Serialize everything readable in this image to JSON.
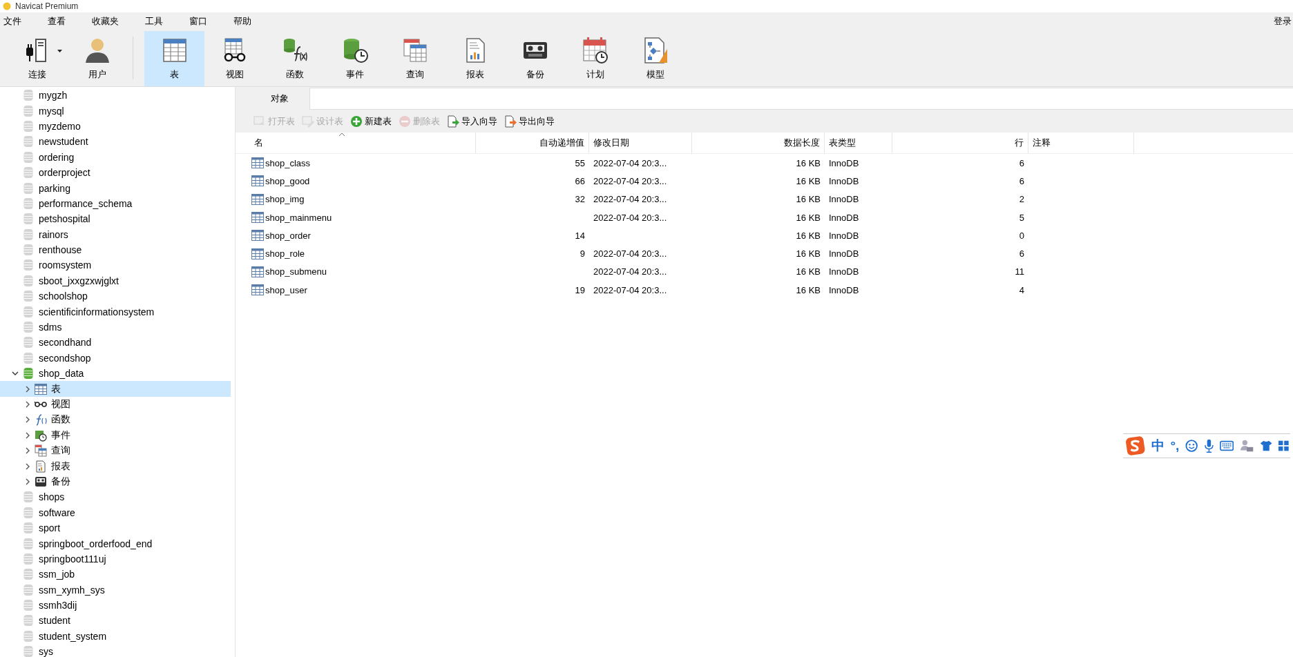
{
  "window": {
    "title": "Navicat Premium"
  },
  "menu": {
    "items": [
      "文件",
      "查看",
      "收藏夹",
      "工具",
      "窗口",
      "帮助"
    ],
    "login": "登录"
  },
  "toolbar": [
    {
      "label": "连接",
      "kind": "connection",
      "selected": false
    },
    {
      "label": "用户",
      "kind": "user",
      "selected": false
    },
    {
      "label": "表",
      "kind": "table",
      "selected": true
    },
    {
      "label": "视图",
      "kind": "view",
      "selected": false
    },
    {
      "label": "函数",
      "kind": "function",
      "selected": false
    },
    {
      "label": "事件",
      "kind": "event",
      "selected": false
    },
    {
      "label": "查询",
      "kind": "query",
      "selected": false
    },
    {
      "label": "报表",
      "kind": "report",
      "selected": false
    },
    {
      "label": "备份",
      "kind": "backup",
      "selected": false
    },
    {
      "label": "计划",
      "kind": "schedule",
      "selected": false
    },
    {
      "label": "模型",
      "kind": "model",
      "selected": false
    }
  ],
  "sidebar": {
    "items": [
      {
        "label": "mygzh",
        "selected": false
      },
      {
        "label": "mysql",
        "selected": false
      },
      {
        "label": "myzdemo",
        "selected": false
      },
      {
        "label": "newstudent",
        "selected": false
      },
      {
        "label": "ordering",
        "selected": false
      },
      {
        "label": "orderproject",
        "selected": false
      },
      {
        "label": "parking",
        "selected": false
      },
      {
        "label": "performance_schema",
        "selected": false
      },
      {
        "label": "petshospital",
        "selected": false
      },
      {
        "label": "rainors",
        "selected": false
      },
      {
        "label": "renthouse",
        "selected": false
      },
      {
        "label": "roomsystem",
        "selected": false
      },
      {
        "label": "sboot_jxxgzxwjglxt",
        "selected": false
      },
      {
        "label": "schoolshop",
        "selected": false
      },
      {
        "label": "scientificinformationsystem",
        "selected": false
      },
      {
        "label": "sdms",
        "selected": false
      },
      {
        "label": "secondhand",
        "selected": false
      },
      {
        "label": "secondshop",
        "selected": false
      },
      {
        "label": "shop_data",
        "selected": false,
        "expanded": true,
        "children": [
          {
            "label": "表",
            "kind": "table",
            "selected": true,
            "expanded": false
          },
          {
            "label": "视图",
            "kind": "view",
            "selected": false,
            "expanded": false
          },
          {
            "label": "函数",
            "kind": "function",
            "selected": false,
            "expanded": false
          },
          {
            "label": "事件",
            "kind": "event",
            "selected": false,
            "expanded": false
          },
          {
            "label": "查询",
            "kind": "query",
            "selected": false,
            "expanded": false
          },
          {
            "label": "报表",
            "kind": "report",
            "selected": false,
            "expanded": false
          },
          {
            "label": "备份",
            "kind": "backup",
            "selected": false,
            "expanded": false
          }
        ]
      },
      {
        "label": "shops",
        "selected": false
      },
      {
        "label": "software",
        "selected": false
      },
      {
        "label": "sport",
        "selected": false
      },
      {
        "label": "springboot_orderfood_end",
        "selected": false
      },
      {
        "label": "springboot111uj",
        "selected": false
      },
      {
        "label": "ssm_job",
        "selected": false
      },
      {
        "label": "ssm_xymh_sys",
        "selected": false
      },
      {
        "label": "ssmh3dij",
        "selected": false
      },
      {
        "label": "student",
        "selected": false
      },
      {
        "label": "student_system",
        "selected": false
      },
      {
        "label": "sys",
        "selected": false
      }
    ]
  },
  "tabs": [
    {
      "label": "对象",
      "selected": true
    }
  ],
  "object_toolbar": [
    {
      "label": "打开表",
      "kind": "open",
      "disabled": true
    },
    {
      "label": "设计表",
      "kind": "design",
      "disabled": true
    },
    {
      "label": "新建表",
      "kind": "new",
      "disabled": false
    },
    {
      "label": "删除表",
      "kind": "delete",
      "disabled": true
    },
    {
      "label": "导入向导",
      "kind": "import",
      "disabled": false
    },
    {
      "label": "导出向导",
      "kind": "export",
      "disabled": false
    }
  ],
  "table": {
    "columns": [
      {
        "label": "名",
        "sorted": true
      },
      {
        "label": "自动递增值",
        "sorted": false
      },
      {
        "label": "修改日期",
        "sorted": false
      },
      {
        "label": "数据长度",
        "sorted": false
      },
      {
        "label": "表类型",
        "sorted": false
      },
      {
        "label": "行",
        "sorted": false
      },
      {
        "label": "注释",
        "sorted": false
      }
    ],
    "rows": [
      {
        "name": "shop_class",
        "auto_increment": "55",
        "modified": "2022-07-04 20:3...",
        "data_length": "16 KB",
        "engine": "InnoDB",
        "rows": "6"
      },
      {
        "name": "shop_good",
        "auto_increment": "66",
        "modified": "2022-07-04 20:3...",
        "data_length": "16 KB",
        "engine": "InnoDB",
        "rows": "6"
      },
      {
        "name": "shop_img",
        "auto_increment": "32",
        "modified": "2022-07-04 20:3...",
        "data_length": "16 KB",
        "engine": "InnoDB",
        "rows": "2"
      },
      {
        "name": "shop_mainmenu",
        "modified": "2022-07-04 20:3...",
        "data_length": "16 KB",
        "engine": "InnoDB",
        "rows": "5"
      },
      {
        "name": "shop_order",
        "auto_increment": "14",
        "data_length": "16 KB",
        "engine": "InnoDB",
        "rows": "0"
      },
      {
        "name": "shop_role",
        "auto_increment": "9",
        "modified": "2022-07-04 20:3...",
        "data_length": "16 KB",
        "engine": "InnoDB",
        "rows": "6"
      },
      {
        "name": "shop_submenu",
        "modified": "2022-07-04 20:3...",
        "data_length": "16 KB",
        "engine": "InnoDB",
        "rows": "11"
      },
      {
        "name": "shop_user",
        "auto_increment": "19",
        "modified": "2022-07-04 20:3...",
        "data_length": "16 KB",
        "engine": "InnoDB",
        "rows": "4"
      }
    ]
  },
  "ime_bar": {
    "mode": "中",
    "punctuation": "°,"
  }
}
